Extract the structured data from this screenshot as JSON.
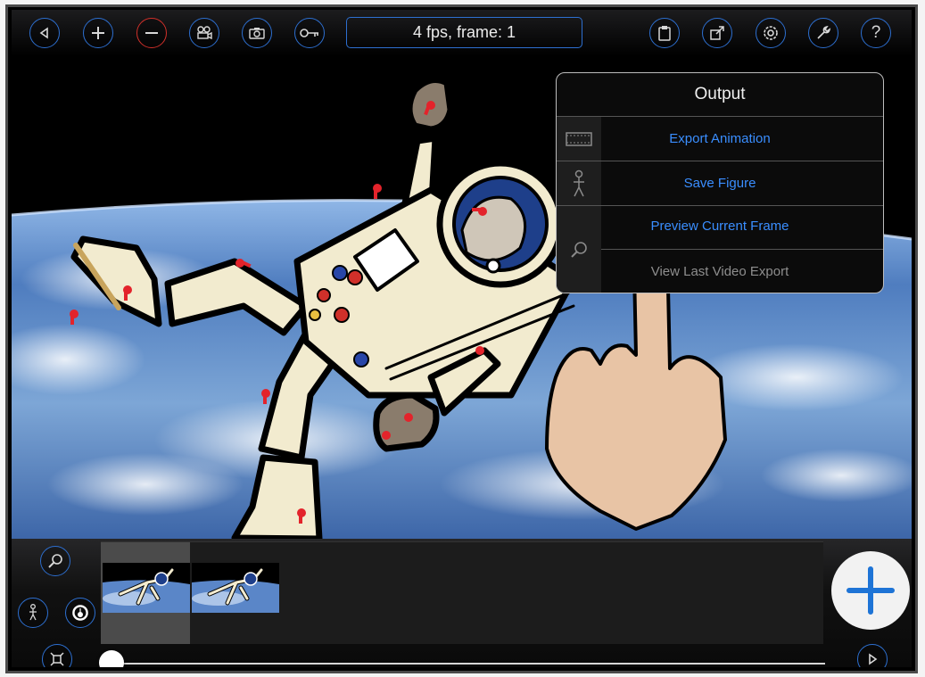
{
  "toolbar": {
    "fps_label": "4 fps, frame: 1",
    "left_icons": [
      "back-icon",
      "plus-icon",
      "minus-icon",
      "camera-icon",
      "snapshot-icon",
      "key-icon"
    ],
    "right_icons": [
      "clipboard-icon",
      "share-icon",
      "settings-icon",
      "wrench-icon",
      "help-icon"
    ],
    "help_glyph": "?"
  },
  "output_menu": {
    "title": "Output",
    "items": [
      {
        "label": "Export Animation",
        "icon": "film-icon",
        "enabled": true
      },
      {
        "label": "Save Figure",
        "icon": "stick-figure-icon",
        "enabled": true
      },
      {
        "label": "Preview Current Frame",
        "icon": "magnifier-icon",
        "enabled": true
      },
      {
        "label": "View Last Video Export",
        "icon": "none",
        "enabled": false
      }
    ]
  },
  "timeline": {
    "frames_shown": 2,
    "selected_frame": 1,
    "slider_position": 0
  },
  "colors": {
    "accent_blue": "#2d6fd0",
    "link_blue": "#3a8eff",
    "joint_red": "#e3232b",
    "danger_red": "#d0302a",
    "plus_blue": "#1e74d6"
  }
}
